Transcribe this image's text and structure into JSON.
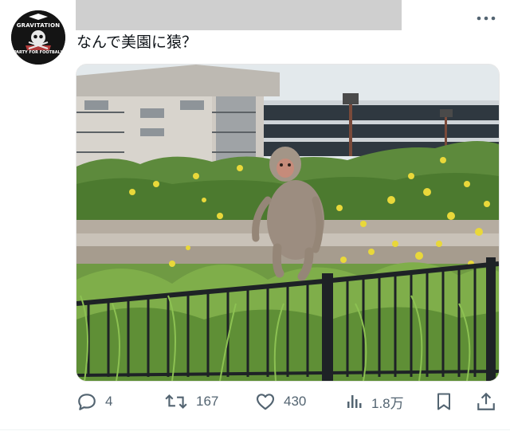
{
  "post": {
    "text": "なんで美園に猿？",
    "author_avatar_text_top": "GRAVITATION",
    "author_avatar_text_bottom": "PARTY FOR FOOTBALL",
    "image_icon": "photo-image"
  },
  "toolbar": {
    "more_icon": "more-horizontal-icon",
    "reply": {
      "icon": "reply-icon",
      "count": "4"
    },
    "repost": {
      "icon": "repost-icon",
      "count": "167"
    },
    "like": {
      "icon": "heart-icon",
      "count": "430"
    },
    "views": {
      "icon": "views-bar-chart-icon",
      "count": "1.8万"
    },
    "bookmark": {
      "icon": "bookmark-icon"
    },
    "share": {
      "icon": "share-icon"
    }
  },
  "colors": {
    "text": "#0f1419",
    "icon": "#536471",
    "redaction": "#cfcfcf"
  }
}
